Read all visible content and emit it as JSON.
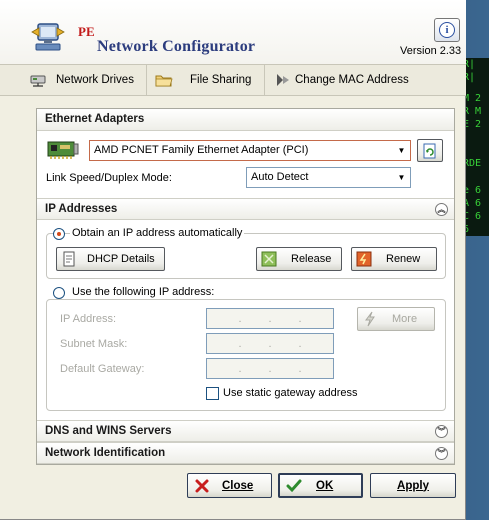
{
  "header": {
    "pe_label": "PE",
    "title": "Network Configurator",
    "version": "Version 2.33",
    "info_glyph": "i"
  },
  "toolbar": {
    "items": [
      {
        "label": "Network Drives",
        "icon": "network-drive-icon"
      },
      {
        "label": "File Sharing",
        "icon": "folder-icon"
      },
      {
        "label": "Change MAC Address",
        "icon": "mac-address-icon"
      }
    ]
  },
  "ethernet": {
    "heading": "Ethernet Adapters",
    "adapter_value": "AMD PCNET Family Ethernet Adapter (PCI)",
    "speed_label": "Link Speed/Duplex Mode:",
    "speed_value": "Auto Detect"
  },
  "ip": {
    "heading": "IP Addresses",
    "auto_label": "Obtain an IP address automatically",
    "dhcp_label": "DHCP Details",
    "release_label": "Release",
    "renew_label": "Renew",
    "manual_label": "Use the following IP address:",
    "ip_label": "IP Address:",
    "subnet_label": "Subnet Mask:",
    "gateway_label": "Default Gateway:",
    "more_label": "More",
    "static_gateway_label": "Use static gateway address",
    "dot": "."
  },
  "dns": {
    "heading": "DNS and WINS Servers"
  },
  "netid": {
    "heading": "Network Identification"
  },
  "footer": {
    "close_label": "Close",
    "ok_label": "OK",
    "apply_label": "Apply"
  },
  "colors": {
    "title": "#2c3c7e",
    "pe": "#c21a1a",
    "radio_dot": "#d44a1a",
    "ok_check": "#2e8b2e",
    "close_x": "#c81e1e"
  },
  "desktop_text": [
    "R|",
    "R|",
    "M 2",
    "R M",
    "E 2",
    "RDE",
    "e 6",
    "A 6",
    "C 6",
    "6"
  ]
}
